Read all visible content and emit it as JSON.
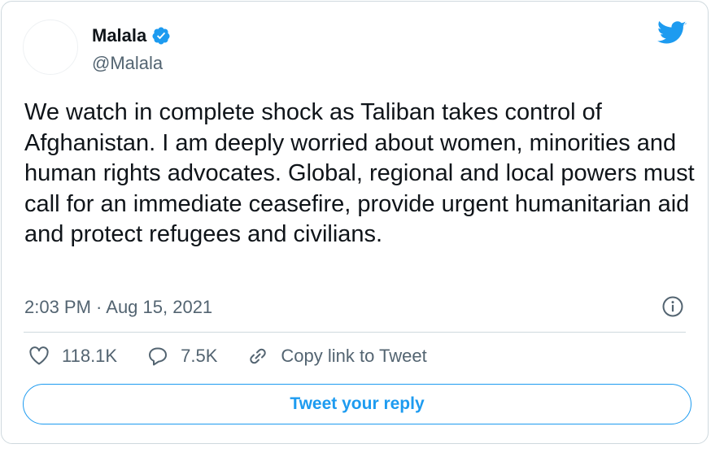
{
  "author": {
    "display_name": "Malala",
    "handle": "@Malala",
    "verified": true
  },
  "tweet": {
    "text": "We watch in complete shock as Taliban takes control of Afghanistan. I am deeply worried about women, minorities and human rights advocates. Global, regional and local powers must call for an immediate ceasefire, provide urgent humanitarian aid and protect refugees and civilians.",
    "timestamp": "2:03 PM · Aug 15, 2021"
  },
  "actions": {
    "likes": "118.1K",
    "replies": "7.5K",
    "copy_link_label": "Copy link to Tweet"
  },
  "reply_button_label": "Tweet your reply",
  "icons": {
    "brand": "twitter-bird-icon",
    "verified": "verified-badge-icon",
    "info": "info-icon",
    "like": "heart-icon",
    "reply": "speech-bubble-icon",
    "link": "link-icon"
  },
  "colors": {
    "accent": "#1d9bf0",
    "text": "#0f1419",
    "secondary": "#536471",
    "border": "#cfd9de"
  }
}
